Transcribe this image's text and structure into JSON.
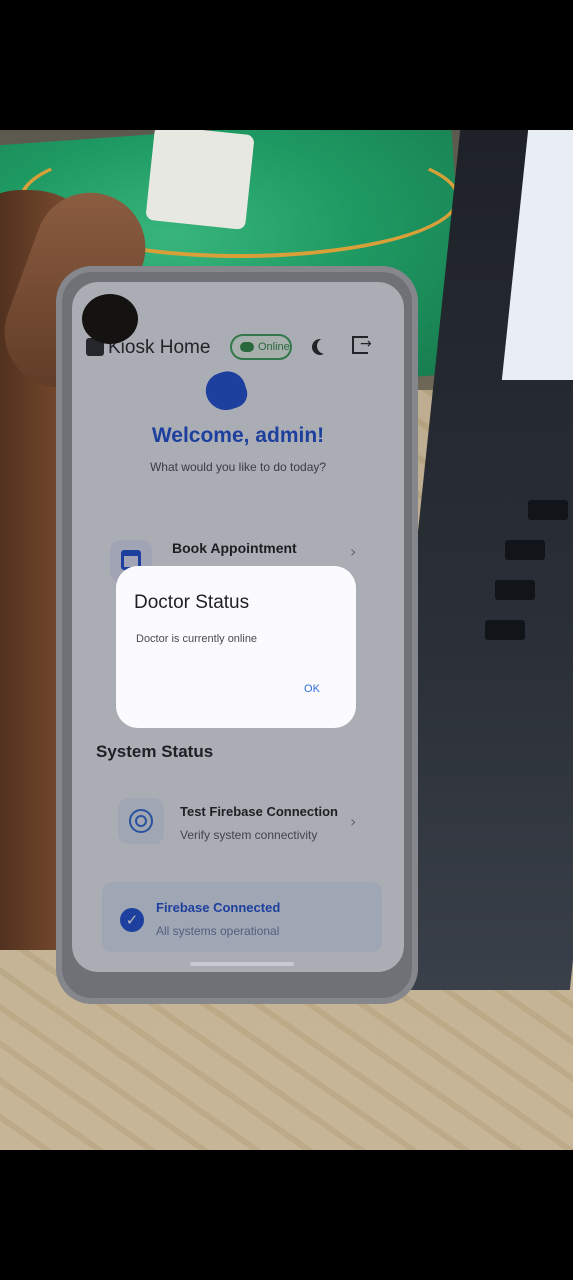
{
  "appbar": {
    "title": "Kiosk Home",
    "status_chip": "Online",
    "status_icon": "cloud-check-icon",
    "theme_icon": "moon-icon",
    "logout_icon": "logout-icon"
  },
  "home": {
    "welcome": "Welcome, admin!",
    "subtitle": "What would you like to do today?",
    "card_book": {
      "title": "Book Appointment",
      "icon": "calendar-icon"
    }
  },
  "dialog": {
    "title": "Doctor Status",
    "body": "Doctor is currently  online",
    "ok": "OK"
  },
  "system": {
    "section_title": "System Status",
    "test_card": {
      "title": "Test Firebase Connection",
      "subtitle": "Verify system connectivity",
      "icon": "signal-icon"
    },
    "banner": {
      "title": "Firebase Connected",
      "subtitle": "All systems operational",
      "icon": "check-circle-icon"
    }
  },
  "colors": {
    "primary": "#1d4fd6",
    "online_green": "#2e8a48",
    "app_bg": "#eef0f6"
  }
}
